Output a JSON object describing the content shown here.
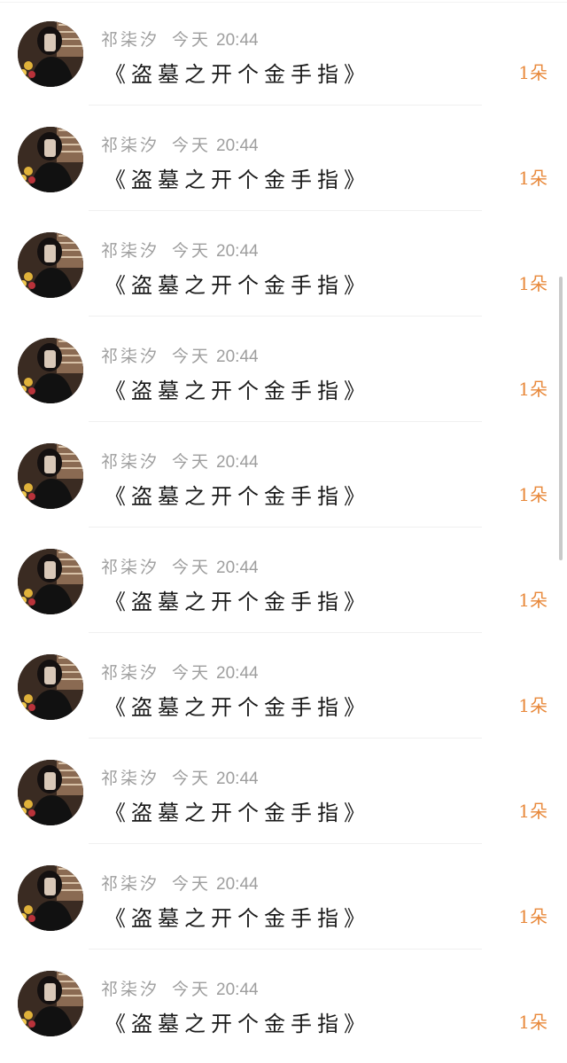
{
  "colors": {
    "background": "#ffffff",
    "meta_text": "#9e9e9e",
    "title_text": "#1a1a1a",
    "count_accent": "#e8883a",
    "divider": "#f0f0f0"
  },
  "gift_list": {
    "items": [
      {
        "sender": "祁柒汐",
        "date": "今天",
        "time": "20:44",
        "book_title": "《盗墓之开个金手指》",
        "count": "1朵",
        "avatar_icon": "user-avatar-icon"
      },
      {
        "sender": "祁柒汐",
        "date": "今天",
        "time": "20:44",
        "book_title": "《盗墓之开个金手指》",
        "count": "1朵",
        "avatar_icon": "user-avatar-icon"
      },
      {
        "sender": "祁柒汐",
        "date": "今天",
        "time": "20:44",
        "book_title": "《盗墓之开个金手指》",
        "count": "1朵",
        "avatar_icon": "user-avatar-icon"
      },
      {
        "sender": "祁柒汐",
        "date": "今天",
        "time": "20:44",
        "book_title": "《盗墓之开个金手指》",
        "count": "1朵",
        "avatar_icon": "user-avatar-icon"
      },
      {
        "sender": "祁柒汐",
        "date": "今天",
        "time": "20:44",
        "book_title": "《盗墓之开个金手指》",
        "count": "1朵",
        "avatar_icon": "user-avatar-icon"
      },
      {
        "sender": "祁柒汐",
        "date": "今天",
        "time": "20:44",
        "book_title": "《盗墓之开个金手指》",
        "count": "1朵",
        "avatar_icon": "user-avatar-icon"
      },
      {
        "sender": "祁柒汐",
        "date": "今天",
        "time": "20:44",
        "book_title": "《盗墓之开个金手指》",
        "count": "1朵",
        "avatar_icon": "user-avatar-icon"
      },
      {
        "sender": "祁柒汐",
        "date": "今天",
        "time": "20:44",
        "book_title": "《盗墓之开个金手指》",
        "count": "1朵",
        "avatar_icon": "user-avatar-icon"
      },
      {
        "sender": "祁柒汐",
        "date": "今天",
        "time": "20:44",
        "book_title": "《盗墓之开个金手指》",
        "count": "1朵",
        "avatar_icon": "user-avatar-icon"
      },
      {
        "sender": "祁柒汐",
        "date": "今天",
        "time": "20:44",
        "book_title": "《盗墓之开个金手指》",
        "count": "1朵",
        "avatar_icon": "user-avatar-icon"
      }
    ]
  }
}
